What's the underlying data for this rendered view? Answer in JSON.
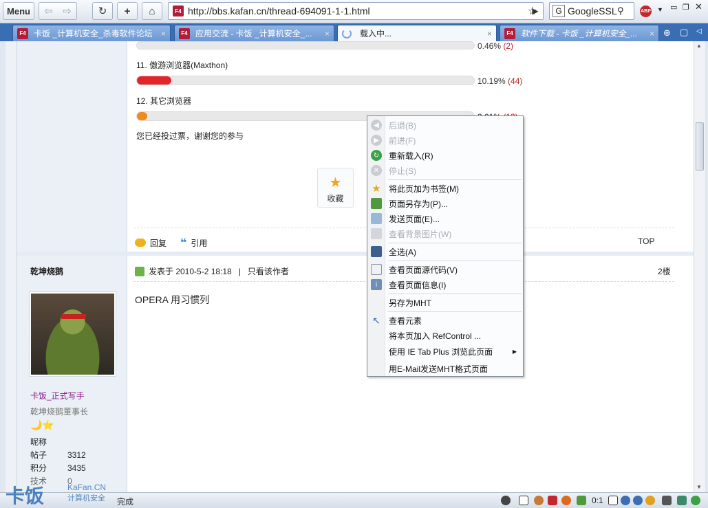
{
  "toolbar": {
    "menu_label": "Menu",
    "url": "http://bbs.kafan.cn/thread-694091-1-1.html",
    "search_value": "GoogleSSL"
  },
  "tabs": [
    {
      "label": "卡饭 _计算机安全_杀毒软件论坛",
      "close": "×"
    },
    {
      "label": "应用交流 - 卡饭 _计算机安全_...",
      "close": "×"
    },
    {
      "label": "载入中...",
      "close": "×"
    },
    {
      "label": "软件下载 - 卡饭 _计算机安全_...",
      "close": "×"
    }
  ],
  "favicon_text": "F4",
  "poll": {
    "row10_pct": "0.46%",
    "row10_count": "(2)",
    "row11_label": "11.  傲游浏览器(Maxthon)",
    "row11_pct": "10.19%",
    "row11_count": "(44)",
    "row11_fraction": 0.1019,
    "row12_label": "12.  其它浏览器",
    "row12_pct": "3.01%",
    "row12_count": "(13)",
    "row12_fraction": 0.0301,
    "voted_text": "您已经投过票，谢谢您的参与",
    "bar_colors": {
      "red": "#e1252b",
      "orange": "#f08a1c"
    }
  },
  "favorite_label": "收藏",
  "actions": {
    "reply": "回复",
    "quote": "引用",
    "top": "TOP"
  },
  "post": {
    "author": "乾坤烧鹅",
    "meta": "发表于 2010-5-2 18:18",
    "separator": "|",
    "only_author": "只看该作者",
    "floor": "2楼",
    "body": "OPERA  用习惯列",
    "rank_title": "卡饭_正式写手",
    "group": "乾坤烧鹅董事长",
    "badge_icons": "🌙⭐",
    "nickname_label": "昵称",
    "stats": [
      {
        "label": "帖子",
        "value": "3312"
      },
      {
        "label": "积分",
        "value": "3435"
      },
      {
        "label": "技术",
        "value": "0"
      }
    ]
  },
  "context_menu": [
    {
      "label": "后退(B)",
      "disabled": true,
      "icon": "back-icon"
    },
    {
      "label": "前进(F)",
      "disabled": true,
      "icon": "forward-icon"
    },
    {
      "label": "重新载入(R)",
      "disabled": false,
      "icon": "reload-icon"
    },
    {
      "label": "停止(S)",
      "disabled": true,
      "icon": "stop-icon"
    },
    {
      "label": "将此页加为书签(M)",
      "disabled": false,
      "icon": "bookmark-star-icon"
    },
    {
      "label": "页面另存为(P)...",
      "disabled": false,
      "icon": "save-page-icon"
    },
    {
      "label": "发送页面(E)...",
      "disabled": false,
      "icon": "send-page-icon"
    },
    {
      "label": "查看背景图片(W)",
      "disabled": true,
      "icon": "background-image-icon"
    },
    {
      "label": "全选(A)",
      "disabled": false,
      "icon": "select-all-icon"
    },
    {
      "label": "查看页面源代码(V)",
      "disabled": false,
      "icon": "page-source-icon"
    },
    {
      "label": "查看页面信息(I)",
      "disabled": false,
      "icon": "page-info-icon"
    },
    {
      "label": "另存为MHT",
      "disabled": false,
      "icon": ""
    },
    {
      "label": "查看元素",
      "disabled": false,
      "icon": "inspect-element-icon"
    },
    {
      "label": "将本页加入 RefControl ...",
      "disabled": false,
      "icon": ""
    },
    {
      "label": "使用 IE Tab Plus 浏览此页面",
      "disabled": false,
      "icon": "",
      "submenu": true
    },
    {
      "label": "用E-Mail发送MHT格式页面",
      "disabled": false,
      "icon": ""
    }
  ],
  "status": {
    "done": "完成",
    "zoom": "0:1"
  },
  "watermark": {
    "main": "卡饭",
    "site": "KaFan.CN",
    "sub": "计算机安全"
  }
}
